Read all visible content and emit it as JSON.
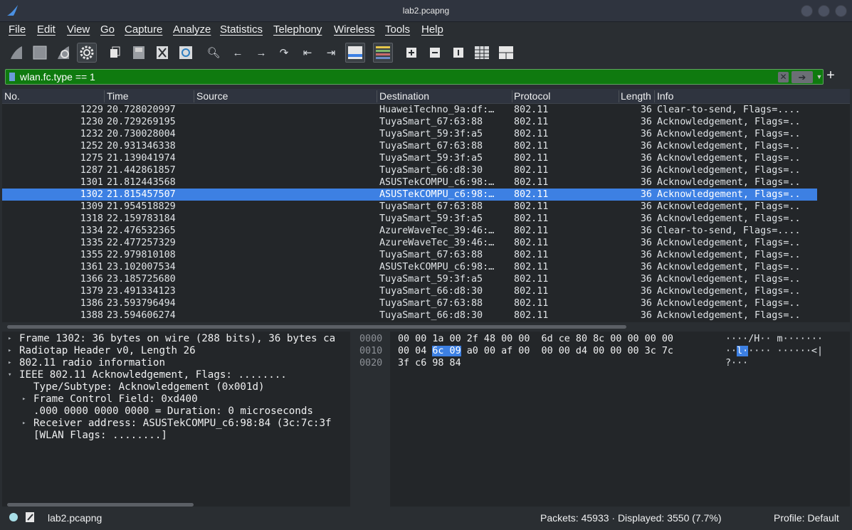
{
  "window": {
    "title": "lab2.pcapng"
  },
  "menu": [
    "File",
    "Edit",
    "View",
    "Go",
    "Capture",
    "Analyze",
    "Statistics",
    "Telephony",
    "Wireless",
    "Tools",
    "Help"
  ],
  "filter": {
    "value": "wlan.fc.type == 1"
  },
  "columns": [
    "No.",
    "Time",
    "Source",
    "Destination",
    "Protocol",
    "Length",
    "Info"
  ],
  "packets": [
    {
      "no": "1229",
      "time": "20.728020997",
      "source": "",
      "dest": "HuaweiTechno_9a:df:…",
      "proto": "802.11",
      "len": "36",
      "info": "Clear-to-send, Flags=...."
    },
    {
      "no": "1230",
      "time": "20.729269195",
      "source": "",
      "dest": "TuyaSmart_67:63:88",
      "proto": "802.11",
      "len": "36",
      "info": "Acknowledgement, Flags=.."
    },
    {
      "no": "1232",
      "time": "20.730028004",
      "source": "",
      "dest": "TuyaSmart_59:3f:a5",
      "proto": "802.11",
      "len": "36",
      "info": "Acknowledgement, Flags=.."
    },
    {
      "no": "1252",
      "time": "20.931346338",
      "source": "",
      "dest": "TuyaSmart_67:63:88",
      "proto": "802.11",
      "len": "36",
      "info": "Acknowledgement, Flags=.."
    },
    {
      "no": "1275",
      "time": "21.139041974",
      "source": "",
      "dest": "TuyaSmart_59:3f:a5",
      "proto": "802.11",
      "len": "36",
      "info": "Acknowledgement, Flags=.."
    },
    {
      "no": "1287",
      "time": "21.442861857",
      "source": "",
      "dest": "TuyaSmart_66:d8:30",
      "proto": "802.11",
      "len": "36",
      "info": "Acknowledgement, Flags=.."
    },
    {
      "no": "1301",
      "time": "21.812443568",
      "source": "",
      "dest": "ASUSTekCOMPU_c6:98:…",
      "proto": "802.11",
      "len": "36",
      "info": "Acknowledgement, Flags=.."
    },
    {
      "no": "1302",
      "time": "21.815457507",
      "source": "",
      "dest": "ASUSTekCOMPU_c6:98:…",
      "proto": "802.11",
      "len": "36",
      "info": "Acknowledgement, Flags=.."
    },
    {
      "no": "1309",
      "time": "21.954518829",
      "source": "",
      "dest": "TuyaSmart_67:63:88",
      "proto": "802.11",
      "len": "36",
      "info": "Acknowledgement, Flags=.."
    },
    {
      "no": "1318",
      "time": "22.159783184",
      "source": "",
      "dest": "TuyaSmart_59:3f:a5",
      "proto": "802.11",
      "len": "36",
      "info": "Acknowledgement, Flags=.."
    },
    {
      "no": "1334",
      "time": "22.476532365",
      "source": "",
      "dest": "AzureWaveTec_39:46:…",
      "proto": "802.11",
      "len": "36",
      "info": "Clear-to-send, Flags=...."
    },
    {
      "no": "1335",
      "time": "22.477257329",
      "source": "",
      "dest": "AzureWaveTec_39:46:…",
      "proto": "802.11",
      "len": "36",
      "info": "Acknowledgement, Flags=.."
    },
    {
      "no": "1355",
      "time": "22.979810108",
      "source": "",
      "dest": "TuyaSmart_67:63:88",
      "proto": "802.11",
      "len": "36",
      "info": "Acknowledgement, Flags=.."
    },
    {
      "no": "1361",
      "time": "23.102007534",
      "source": "",
      "dest": "ASUSTekCOMPU_c6:98:…",
      "proto": "802.11",
      "len": "36",
      "info": "Acknowledgement, Flags=.."
    },
    {
      "no": "1366",
      "time": "23.185725680",
      "source": "",
      "dest": "TuyaSmart_59:3f:a5",
      "proto": "802.11",
      "len": "36",
      "info": "Acknowledgement, Flags=.."
    },
    {
      "no": "1379",
      "time": "23.491334123",
      "source": "",
      "dest": "TuyaSmart_66:d8:30",
      "proto": "802.11",
      "len": "36",
      "info": "Acknowledgement, Flags=.."
    },
    {
      "no": "1386",
      "time": "23.593796494",
      "source": "",
      "dest": "TuyaSmart_67:63:88",
      "proto": "802.11",
      "len": "36",
      "info": "Acknowledgement, Flags=.."
    },
    {
      "no": "1388",
      "time": "23.594606274",
      "source": "",
      "dest": "TuyaSmart_66:d8:30",
      "proto": "802.11",
      "len": "36",
      "info": "Acknowledgement, Flags=.."
    }
  ],
  "selected_no": "1302",
  "details": [
    {
      "arrow": "right",
      "indent": 0,
      "text": "Frame 1302: 36 bytes on wire (288 bits), 36 bytes ca"
    },
    {
      "arrow": "right",
      "indent": 0,
      "text": "Radiotap Header v0, Length 26"
    },
    {
      "arrow": "right",
      "indent": 0,
      "text": "802.11 radio information"
    },
    {
      "arrow": "down",
      "indent": 0,
      "text": "IEEE 802.11 Acknowledgement, Flags: ........"
    },
    {
      "arrow": "none",
      "indent": 1,
      "text": "Type/Subtype: Acknowledgement (0x001d)"
    },
    {
      "arrow": "right",
      "indent": 1,
      "text": "Frame Control Field: 0xd400"
    },
    {
      "arrow": "none",
      "indent": 1,
      "text": ".000 0000 0000 0000 = Duration: 0 microseconds"
    },
    {
      "arrow": "right",
      "indent": 1,
      "text": "Receiver address: ASUSTekCOMPU_c6:98:84 (3c:7c:3f"
    },
    {
      "arrow": "none",
      "indent": 1,
      "text": "[WLAN Flags: ........]"
    }
  ],
  "hex": [
    {
      "offset": "0000",
      "pre": "00 00 1a 00 2f 48 00 00  6d ce 80 8c 00 00 00 00",
      "hl": "",
      "post": "",
      "ascii_pre": "····/H·· m·······",
      "ascii_hl": "",
      "ascii_post": ""
    },
    {
      "offset": "0010",
      "pre": "00 04 ",
      "hl": "6c 09",
      "post": " a0 00 af 00  00 00 d4 00 00 00 3c 7c",
      "ascii_pre": "··",
      "ascii_hl": "l·",
      "ascii_post": "···· ······<|"
    },
    {
      "offset": "0020",
      "pre": "3f c6 98 84",
      "hl": "",
      "post": "",
      "ascii_pre": "?···",
      "ascii_hl": "",
      "ascii_post": ""
    }
  ],
  "status": {
    "file": "lab2.pcapng",
    "packets": "Packets: 45933 · Displayed: 3550 (7.7%)",
    "profile": "Profile: Default"
  },
  "colors": {
    "selection": "#3d80e3",
    "filter_valid": "#0f7a0f"
  }
}
